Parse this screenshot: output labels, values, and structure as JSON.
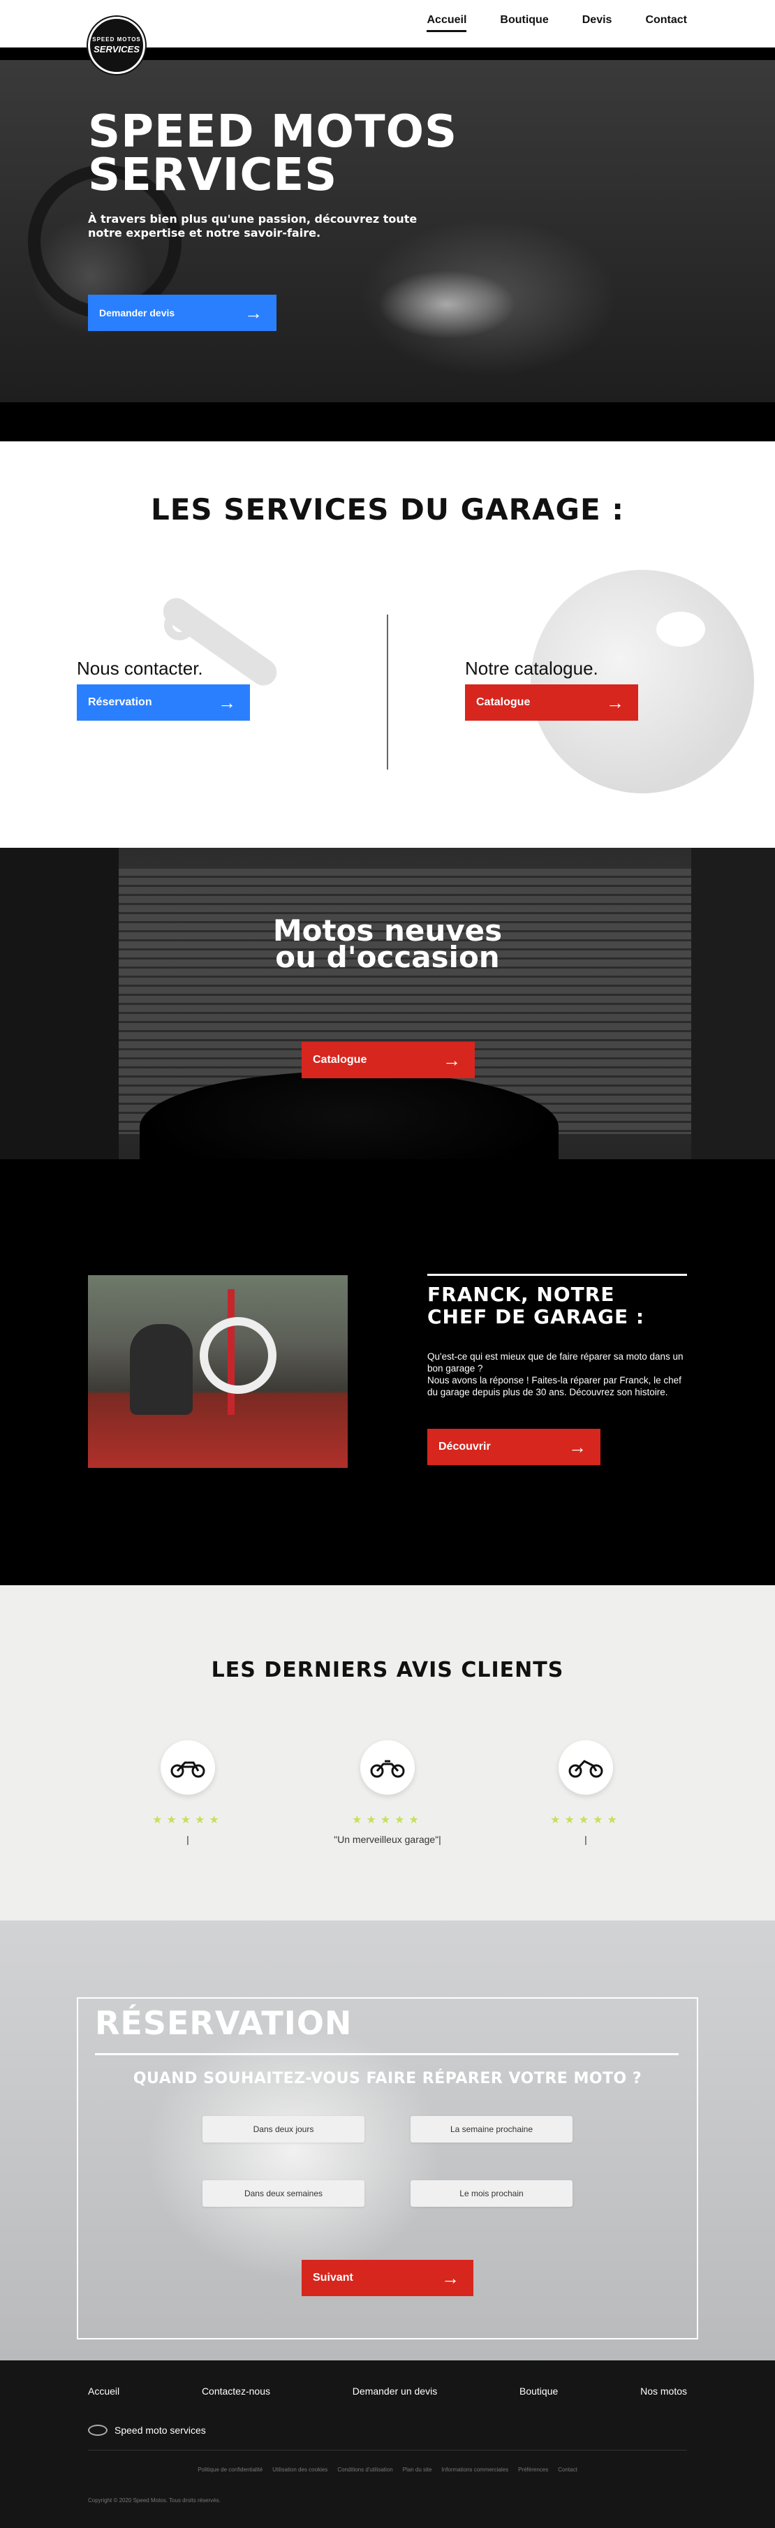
{
  "nav": {
    "logo": {
      "line1": "SPEED MOTOS",
      "line2": "SERVICES",
      "line3": ""
    },
    "links": [
      "Accueil",
      "Boutique",
      "Devis",
      "Contact"
    ]
  },
  "hero": {
    "title_line1": "SPEED MOTOS",
    "title_line2": "SERVICES",
    "subtitle": "À travers bien plus qu'une passion, découvrez toute notre expertise et notre savoir-faire.",
    "cta": "Demander devis"
  },
  "services": {
    "title": "LES SERVICES DU GARAGE :",
    "left_label": "Nous contacter.",
    "left_button": "Réservation",
    "right_label": "Notre catalogue.",
    "right_button": "Catalogue"
  },
  "motos": {
    "title_line1": "Motos neuves",
    "title_line2": "ou d'occasion",
    "button": "Catalogue"
  },
  "franck": {
    "title_line1": "FRANCK, NOTRE",
    "title_line2": "CHEF DE GARAGE :",
    "text": "Qu'est-ce qui est mieux que de faire réparer sa moto dans un bon garage ?\nNous avons la réponse ! Faites-la réparer par Franck, le chef du garage depuis plus de 30 ans. Découvrez son histoire.",
    "button": "Découvrir"
  },
  "avis": {
    "title": "LES DERNIERS AVIS CLIENTS",
    "items": [
      {
        "stars": "★★★★★",
        "quote": "|"
      },
      {
        "stars": "★★★★★",
        "quote": "\"Un merveilleux garage\"|"
      },
      {
        "stars": "★★★★★",
        "quote": "|"
      }
    ]
  },
  "reservation": {
    "title": "RÉSERVATION",
    "question": "QUAND SOUHAITEZ-VOUS FAIRE RÉPARER VOTRE MOTO ?",
    "options": [
      "Dans deux jours",
      "La semaine prochaine",
      "Dans deux semaines",
      "Le mois prochain"
    ],
    "next": "Suivant"
  },
  "footer": {
    "links": [
      "Accueil",
      "Contactez-nous",
      "Demander un devis",
      "Boutique",
      "Nos motos"
    ],
    "brand": "Speed moto services",
    "legal": [
      "Politique de confidentialité",
      "Utilisation des cookies",
      "Conditions d'utilisation",
      "Plan du site",
      "Informations commerciales",
      "Préférences",
      "Contact"
    ],
    "copyright": "Copyright © 2020 Speed Motos. Tous droits réservés."
  },
  "colors": {
    "blue": "#2a7fff",
    "red": "#d7261e",
    "star": "#c6e05a",
    "footer_bg": "#151515"
  }
}
